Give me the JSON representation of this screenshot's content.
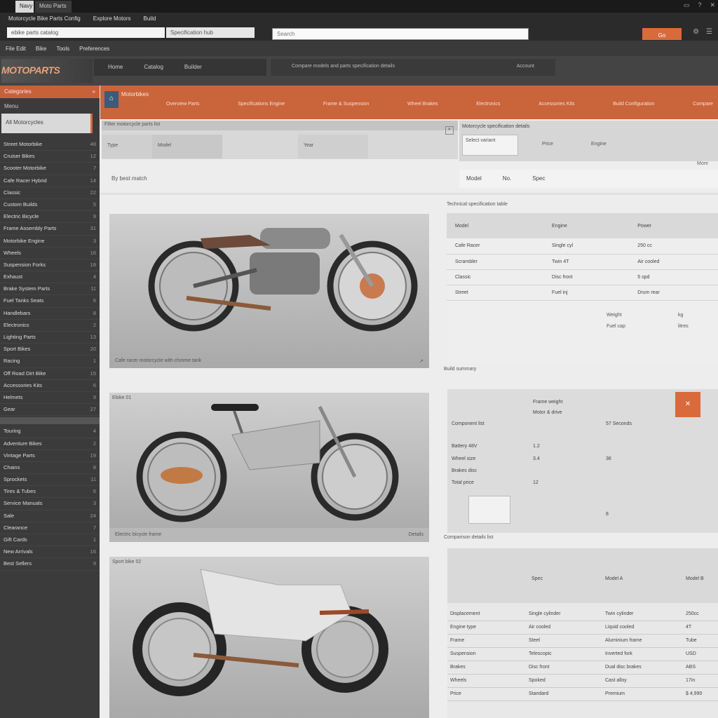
{
  "window": {
    "tabs": [
      "Navy",
      "Moto Parts"
    ],
    "icons": [
      "window-icon",
      "help-icon",
      "close-icon"
    ]
  },
  "toolbar": {
    "row1": [
      "Motorcycle Bike Parts Config",
      "Explore Motors",
      "Build"
    ],
    "address": "ebike parts catalog",
    "address_suffix": "Specification hub",
    "search_placeholder": "Search",
    "accent_button": "Go",
    "accent_color": "#d86a3c"
  },
  "menubar": [
    "File  Edit",
    "Bike",
    "Tools",
    "Preferences"
  ],
  "banner": {
    "logo": "MOTOPARTS",
    "nav": [
      "Home",
      "Catalog",
      "Builder"
    ],
    "nav2": [
      "Compare models and parts specification details",
      "Account"
    ]
  },
  "sidebar": {
    "header": "Categories",
    "header_count": "»",
    "sub": "Menu",
    "active": "All Motorcycles",
    "items": [
      {
        "label": "Street Motorbike",
        "count": "48"
      },
      {
        "label": "Cruiser Bikes",
        "count": "12"
      },
      {
        "label": "Scooter Motorbike",
        "count": "7"
      },
      {
        "label": "Cafe Racer Hybrid",
        "count": "14"
      },
      {
        "label": "Classic",
        "count": "22"
      },
      {
        "label": "Custom Builds",
        "count": "5"
      },
      {
        "label": "Electric Bicycle",
        "count": "9"
      },
      {
        "label": "Frame Assembly Parts",
        "count": "31"
      },
      {
        "label": "Motorbike Engine",
        "count": "3"
      },
      {
        "label": "Wheels",
        "count": "16"
      },
      {
        "label": "Suspension Forks",
        "count": "18"
      },
      {
        "label": "Exhaust",
        "count": "4"
      },
      {
        "label": "Brake System Parts",
        "count": "11"
      },
      {
        "label": "Fuel Tanks Seats",
        "count": "6"
      },
      {
        "label": "Handlebars",
        "count": "8"
      },
      {
        "label": "Electronics",
        "count": "2"
      },
      {
        "label": "Lighting Parts",
        "count": "13"
      },
      {
        "label": "Sport Bikes",
        "count": "20"
      },
      {
        "label": "Racing",
        "count": "1"
      },
      {
        "label": "Off Road Dirt Bike",
        "count": "15"
      },
      {
        "label": "Accessories Kits",
        "count": "6"
      },
      {
        "label": "Helmets",
        "count": "9"
      },
      {
        "label": "Gear",
        "count": "27"
      }
    ],
    "items2": [
      {
        "label": "Touring",
        "count": "4"
      },
      {
        "label": "Adventure Bikes",
        "count": "2"
      },
      {
        "label": "Vintage Parts",
        "count": "19"
      },
      {
        "label": "Chains",
        "count": "8"
      },
      {
        "label": "Sprockets",
        "count": "11"
      },
      {
        "label": "Tires & Tubes",
        "count": "6"
      },
      {
        "label": "Service Manuals",
        "count": "3"
      },
      {
        "label": "Sale",
        "count": "24"
      },
      {
        "label": "Clearance",
        "count": "7"
      },
      {
        "label": "Gift Cards",
        "count": "1"
      },
      {
        "label": "New Arrivals",
        "count": "16"
      },
      {
        "label": "Best Sellers",
        "count": "9"
      }
    ]
  },
  "main": {
    "crumb": "Motorbikes",
    "tabs": [
      "Overview Parts",
      "Specifications Engine",
      "Frame & Suspension",
      "Wheel Brakes",
      "Electronics",
      "Accessories Kits",
      "Build Configuration",
      "Compare"
    ],
    "filters_strip": "Filter motorcycle parts list",
    "filter_segments": [
      "Type",
      "Model",
      "Year"
    ],
    "spec_label": "Motorcycle specification details",
    "spec_drop": "Select variant",
    "spec_cols": [
      "Price",
      "Engine"
    ],
    "spec_foot": "More",
    "results": "By best match",
    "spec_row": [
      "Model",
      "No.",
      "Spec"
    ],
    "photos": [
      {
        "top": "",
        "bottom": "Cafe racer motorcycle with chrome tank",
        "badge": "↗"
      },
      {
        "top": "Ebike 01",
        "bottom": "Electric bicycle frame",
        "badge": "Details"
      },
      {
        "top": "Sport bike 02",
        "bottom": "",
        "badge": ""
      }
    ],
    "table1_title": "Technical specification table",
    "table1_head": [
      "Model",
      "Engine",
      "Power"
    ],
    "table1_rows": [
      [
        "Cafe Racer",
        "Single cyl",
        "250 cc"
      ],
      [
        "Scrambler",
        "Twin 4T",
        "Air cooled"
      ],
      [
        "Classic",
        "Disc front",
        "5 spd"
      ],
      [
        "Street",
        "Fuel inj",
        "Drum rear"
      ]
    ],
    "table1_extra": [
      "Weight",
      "Fuel cap",
      "kg",
      "litres"
    ],
    "detail_title": "Build summary",
    "detail_labels": [
      "Frame weight",
      "Motor & drive",
      "Component list",
      "Battery 48V",
      "Wheel size",
      "Brakes disc",
      "Total price"
    ],
    "detail_values": [
      "57 Seconds",
      "1.2",
      "3.4",
      "36",
      "12",
      "8"
    ],
    "detail_tag": "✕",
    "table2_title": "Comparison details list",
    "table2_head": [
      "Spec",
      "Model A",
      "Model B"
    ],
    "table2_rows": [
      [
        "Displacement",
        "Single cylinder",
        "Twin cylinder",
        "250cc"
      ],
      [
        "Engine type",
        "Air cooled",
        "Liquid cooled",
        "4T"
      ],
      [
        "Frame",
        "Steel",
        "Aluminium frame",
        "Tube"
      ],
      [
        "Suspension",
        "Telescopic",
        "Inverted fork",
        "USD"
      ],
      [
        "Brakes",
        "Disc front",
        "Dual disc brakes",
        "ABS"
      ],
      [
        "Wheels",
        "Spoked",
        "Cast alloy",
        "17in"
      ],
      [
        "Price",
        "Standard",
        "Premium",
        "$ 4,990"
      ]
    ]
  }
}
